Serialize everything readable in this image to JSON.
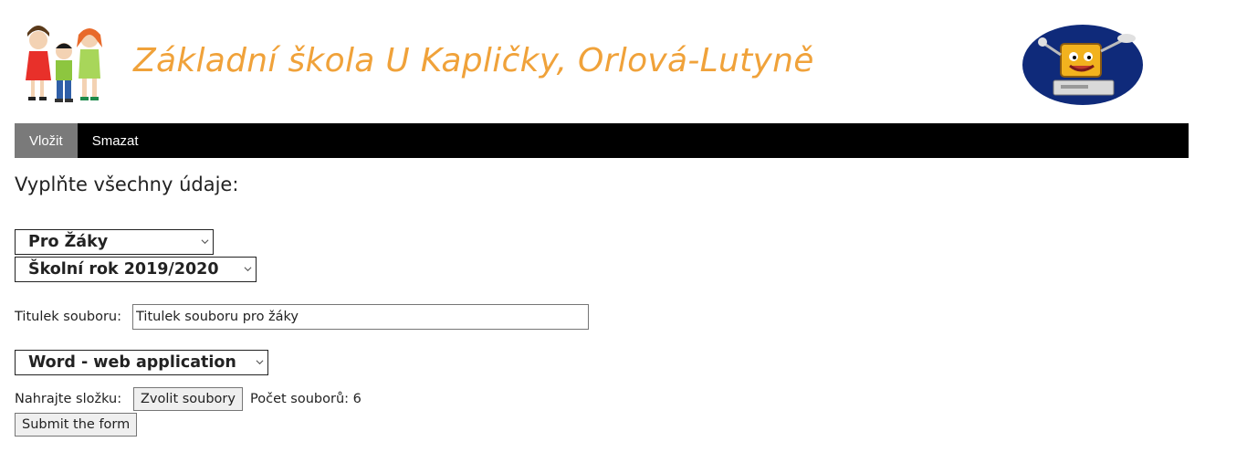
{
  "header": {
    "title": "Základní škola U Kapličky, Orlová-Lutyně",
    "title_color": "#f0a23a"
  },
  "nav": {
    "items": [
      {
        "label": "Vložit",
        "active": true
      },
      {
        "label": "Smazat",
        "active": false
      }
    ]
  },
  "form": {
    "heading": "Vyplňte všechny údaje:",
    "audience_select": "Pro Žáky",
    "year_select": "Školní rok 2019/2020",
    "title_label": "Titulek souboru:",
    "title_value": "Titulek souboru pro žáky",
    "type_select": "Word - web application",
    "upload_label": "Nahrajte složku:",
    "choose_files_button": "Zvolit soubory",
    "file_count_text": "Počet souborů: 6",
    "submit_button": "Submit the form"
  },
  "colors": {
    "navbar_bg": "#000000",
    "nav_active_bg": "#7a7a7a",
    "logo_bg": "#0f2a7a"
  }
}
